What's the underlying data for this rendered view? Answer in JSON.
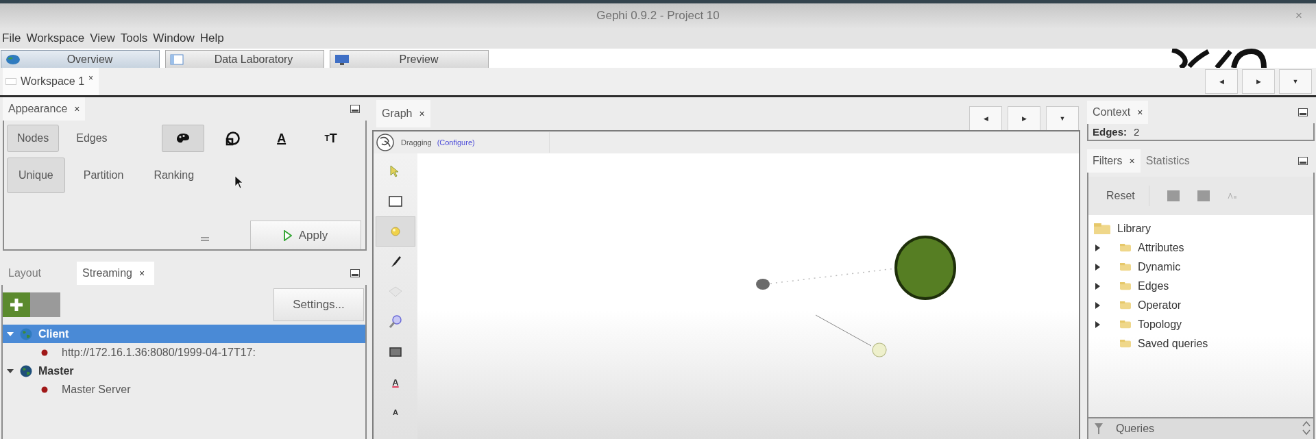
{
  "window": {
    "title": "Gephi 0.9.2 - Project 10",
    "close": "×"
  },
  "menu": [
    "File",
    "Workspace",
    "View",
    "Tools",
    "Window",
    "Help"
  ],
  "perspectives": [
    {
      "label": "Overview",
      "kind": "overview",
      "selected": true
    },
    {
      "label": "Data Laboratory",
      "kind": "data",
      "selected": false
    },
    {
      "label": "Preview",
      "kind": "preview",
      "selected": false
    }
  ],
  "workspace_tabs": [
    {
      "label": "Workspace 1",
      "close": "×",
      "selected": true
    }
  ],
  "workspace_nav": [
    "◀",
    "▶",
    "▼"
  ],
  "appearance": {
    "title": "Appearance",
    "close": "×",
    "element_tabs": [
      {
        "label": "Nodes",
        "selected": true
      },
      {
        "label": "Edges",
        "selected": false
      }
    ],
    "attribute_tools": [
      {
        "kind": "color",
        "selected": true
      },
      {
        "kind": "size",
        "selected": false
      },
      {
        "kind": "label_color",
        "glyph": "A",
        "selected": false
      },
      {
        "kind": "label_size",
        "glyph": "TT",
        "selected": false
      }
    ],
    "modes": [
      {
        "label": "Unique",
        "selected": true
      },
      {
        "label": "Partition",
        "selected": false
      },
      {
        "label": "Ranking",
        "selected": false
      }
    ],
    "apply": "Apply"
  },
  "streaming": {
    "tabs": [
      {
        "label": "Layout",
        "selected": false
      },
      {
        "label": "Streaming",
        "close": "×",
        "selected": true
      }
    ],
    "settings": "Settings...",
    "tree": [
      {
        "label": "Client",
        "selected": true,
        "expanded": true,
        "children": [
          {
            "label": "http://172.16.1.36:8080/1999-04-17T17:"
          }
        ]
      },
      {
        "label": "Master",
        "selected": false,
        "expanded": true,
        "children": [
          {
            "label": "Master Server"
          }
        ]
      }
    ]
  },
  "graph": {
    "title": "Graph",
    "close": "×",
    "nav": [
      "◀",
      "▶",
      "▼"
    ],
    "tool_name": "Dragging",
    "configure": "(Configure)",
    "tools": [
      {
        "kind": "select",
        "selected": false
      },
      {
        "kind": "rectangle",
        "selected": false
      },
      {
        "kind": "drag",
        "selected": true
      },
      {
        "kind": "brush",
        "selected": false
      },
      {
        "kind": "diamond",
        "selected": false
      },
      {
        "kind": "zoom",
        "selected": false
      },
      {
        "kind": "screen",
        "selected": false
      },
      {
        "kind": "label_color",
        "glyph": "A",
        "selected": false
      },
      {
        "kind": "label_size",
        "glyph": "A",
        "selected": false
      }
    ]
  },
  "context": {
    "title": "Context",
    "close": "×",
    "stats": [
      {
        "label": "Edges:",
        "value": "2"
      }
    ]
  },
  "filters": {
    "tabs": [
      {
        "label": "Filters",
        "close": "×",
        "selected": true
      },
      {
        "label": "Statistics",
        "selected": false
      }
    ],
    "reset": "Reset",
    "library": {
      "label": "Library",
      "children": [
        {
          "label": "Attributes",
          "expandable": true
        },
        {
          "label": "Dynamic",
          "expandable": true
        },
        {
          "label": "Edges",
          "expandable": true
        },
        {
          "label": "Operator",
          "expandable": true
        },
        {
          "label": "Topology",
          "expandable": true
        },
        {
          "label": "Saved queries",
          "expandable": false
        }
      ]
    },
    "queries": "Queries"
  }
}
